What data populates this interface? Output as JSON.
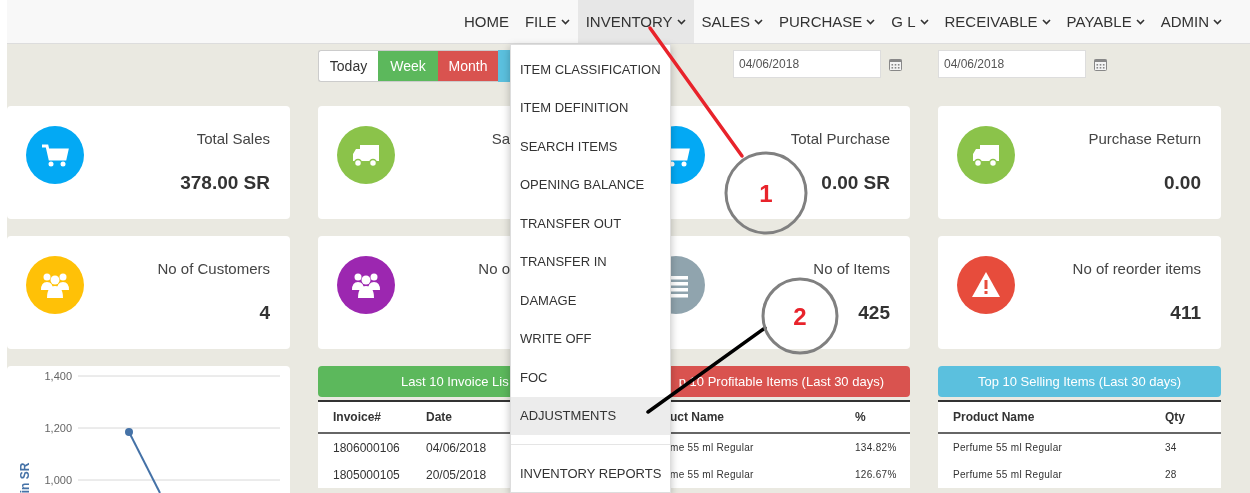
{
  "nav": [
    {
      "label": "HOME",
      "has_menu": false,
      "selected": false
    },
    {
      "label": "FILE",
      "has_menu": true,
      "selected": false
    },
    {
      "label": "INVENTORY",
      "has_menu": true,
      "selected": true
    },
    {
      "label": "SALES",
      "has_menu": true,
      "selected": false
    },
    {
      "label": "PURCHASE",
      "has_menu": true,
      "selected": false
    },
    {
      "label": "G L",
      "has_menu": true,
      "selected": false
    },
    {
      "label": "RECEIVABLE",
      "has_menu": true,
      "selected": false
    },
    {
      "label": "PAYABLE",
      "has_menu": true,
      "selected": false
    },
    {
      "label": "ADMIN",
      "has_menu": true,
      "selected": false
    }
  ],
  "inventory_menu": [
    {
      "label": "ITEM CLASSIFICATION",
      "selected": false
    },
    {
      "label": "ITEM DEFINITION",
      "selected": false
    },
    {
      "label": "SEARCH ITEMS",
      "selected": false
    },
    {
      "label": "OPENING BALANCE",
      "selected": false
    },
    {
      "label": "TRANSFER OUT",
      "selected": false
    },
    {
      "label": "TRANSFER IN",
      "selected": false
    },
    {
      "label": "DAMAGE",
      "selected": false
    },
    {
      "label": "WRITE OFF",
      "selected": false
    },
    {
      "label": "FOC",
      "selected": false
    },
    {
      "label": "ADJUSTMENTS",
      "selected": true
    },
    {
      "kind": "divider"
    },
    {
      "label": "INVENTORY REPORTS",
      "selected": false
    }
  ],
  "period_buttons": [
    {
      "label": "Today",
      "color": "#ffffff"
    },
    {
      "label": "Week",
      "color": "#5cb85c"
    },
    {
      "label": "Month",
      "color": "#d9534f"
    },
    {
      "color": "#5bc0de"
    }
  ],
  "date_from": {
    "value": "04/06/2018"
  },
  "date_to": {
    "value": "04/06/2018"
  },
  "cards": [
    {
      "label": "Total Sales",
      "value": "378.00 SR",
      "color": "#03a9f4"
    },
    {
      "label": "Sa",
      "color": "#8bc34a"
    },
    {
      "label": "Total Purchase",
      "value": "0.00 SR",
      "color": "#03a9f4"
    },
    {
      "label": "Purchase Return",
      "value": "0.00",
      "color": "#8bc34a"
    },
    {
      "label": "No of Customers",
      "value": "4",
      "color": "#ffc107"
    },
    {
      "label": "No o",
      "color": "#9c27b0"
    },
    {
      "label": "No of Items",
      "value": "425",
      "color": "#90a4ae"
    },
    {
      "label": "No of reorder items",
      "value": "411",
      "color": "#e74c3c"
    }
  ],
  "sales_chart": {
    "axis_title": "in SR",
    "tick_labels": [
      "1,400",
      "1,200",
      "1,000"
    ]
  },
  "panels": [
    {
      "title": "Last 10 Invoice Lis",
      "color": "#5cb85c",
      "columns": [
        "Invoice#",
        "Date"
      ],
      "rows": [
        [
          "1806000106",
          "04/06/2018"
        ],
        [
          "1805000105",
          "20/05/2018"
        ]
      ]
    },
    {
      "title": "p 10 Profitable Items (Last 30 days)",
      "color": "#d9534f",
      "columns": [
        "uct Name",
        "%"
      ],
      "rows": [
        [
          "me 55 ml Regular",
          "134.82%"
        ],
        [
          "me 55 ml Regular",
          "126.67%"
        ]
      ]
    },
    {
      "title": "Top 10 Selling Items (Last 30 days)",
      "color": "#5bc0de",
      "columns": [
        "Product Name",
        "Qty"
      ],
      "rows": [
        [
          "Perfume 55 ml Regular",
          "34"
        ],
        [
          "Perfume 55 ml Regular",
          "28"
        ]
      ]
    }
  ],
  "annotations": [
    {
      "number": "1",
      "color": "#e8232b"
    },
    {
      "number": "2",
      "color": "#000000"
    }
  ]
}
